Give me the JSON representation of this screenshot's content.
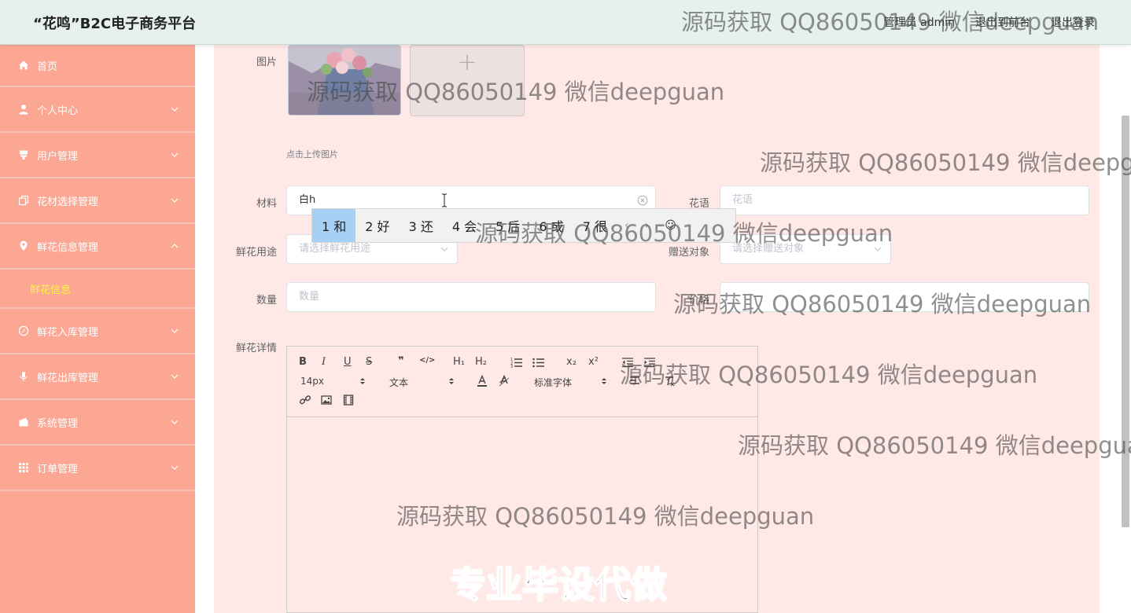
{
  "header": {
    "brand": "“花鸣”B2C电子商务平台",
    "user_label": "管理员 admin",
    "front_link": "退出到前台",
    "logout": "退出登录"
  },
  "sidebar": {
    "items": [
      {
        "label": "首页",
        "icon": "home-icon"
      },
      {
        "label": "个人中心",
        "icon": "user-icon"
      },
      {
        "label": "用户管理",
        "icon": "users-icon"
      },
      {
        "label": "花材选择管理",
        "icon": "copy-icon"
      },
      {
        "label": "鲜花信息管理",
        "icon": "location-icon",
        "expanded": true
      },
      {
        "label": "鲜花入库管理",
        "icon": "compass-icon"
      },
      {
        "label": "鲜花出库管理",
        "icon": "microphone-icon"
      },
      {
        "label": "系统管理",
        "icon": "wallet-icon"
      },
      {
        "label": "订单管理",
        "icon": "grid-icon"
      }
    ],
    "submenu": {
      "label": "鲜花信息"
    }
  },
  "form": {
    "image_label": "图片",
    "upload_plus": "+",
    "upload_tip": "点击上传图片",
    "material_label": "材料",
    "material_value": "白h",
    "flower_lang_label": "花语",
    "flower_lang_placeholder": "花语",
    "usage_label": "鲜花用途",
    "usage_placeholder": "请选择鲜花用途",
    "recipient_label": "赠送对象",
    "recipient_placeholder": "请选择赠送对象",
    "quantity_label": "数量",
    "quantity_placeholder": "数量",
    "price_label": "价格",
    "detail_label": "鲜花详情"
  },
  "ime": {
    "candidates": [
      "1 和",
      "2 好",
      "3 还",
      "4 会",
      "5 后",
      "6 或",
      "7 很"
    ],
    "prev": "‹",
    "next": "›",
    "emoji": "☺"
  },
  "editor": {
    "buttons": [
      "B",
      "I",
      "U",
      "S",
      "❞",
      "</>",
      "H₁",
      "H₂",
      "x₂",
      "x²"
    ],
    "font_size": "14px",
    "text_type": "文本",
    "font_family": "标准字体"
  },
  "watermarks": {
    "text": "源码获取 QQ86050149 微信deepguan",
    "big": "专业毕设代做"
  },
  "colors": {
    "header_bg": "#e6f1ec",
    "sidebar_bg": "#fca794",
    "panel_bg": "#fee9e6",
    "active_submenu": "#fff34a",
    "ime_selected": "#a8d0f5"
  }
}
